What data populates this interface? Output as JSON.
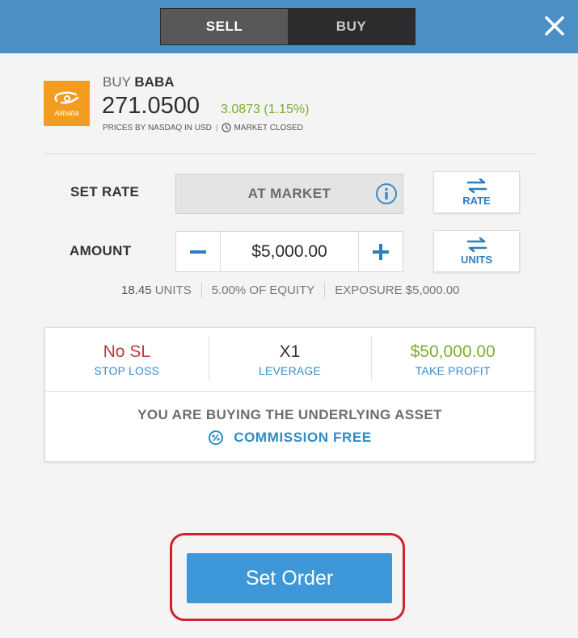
{
  "header": {
    "tabs": {
      "sell": "SELL",
      "buy": "BUY"
    },
    "active_tab": "SELL",
    "header_color": "#4a90c6"
  },
  "instrument": {
    "action": "BUY",
    "symbol": "BABA",
    "logo_text": "Alibaba",
    "price": "271.0500",
    "change": "3.0873 (1.15%)",
    "change_color": "#7cae2f",
    "source": "PRICES BY NASDAQ IN USD",
    "market_status": "MARKET CLOSED"
  },
  "rate": {
    "label": "SET RATE",
    "value": "AT MARKET",
    "toggle_label": "RATE"
  },
  "amount": {
    "label": "AMOUNT",
    "value": "$5,000.00",
    "toggle_label": "UNITS"
  },
  "stats": {
    "units_value": "18.45",
    "units_label": "UNITS",
    "equity": "5.00% OF EQUITY",
    "exposure": "EXPOSURE $5,000.00"
  },
  "risk": {
    "stop_loss_value": "No SL",
    "stop_loss_label": "STOP LOSS",
    "leverage_value": "X1",
    "leverage_label": "LEVERAGE",
    "take_profit_value": "$50,000.00",
    "take_profit_label": "TAKE PROFIT",
    "colors": {
      "stop_loss": "#c0393b",
      "leverage": "#333333",
      "take_profit": "#7cae2f",
      "labels": "#3a8cc8"
    }
  },
  "notice": {
    "underlying": "YOU ARE BUYING THE UNDERLYING ASSET",
    "commission": "COMMISSION FREE"
  },
  "footer": {
    "set_order": "Set Order",
    "button_color": "#3d97d8",
    "highlight_color": "#d1202e"
  }
}
